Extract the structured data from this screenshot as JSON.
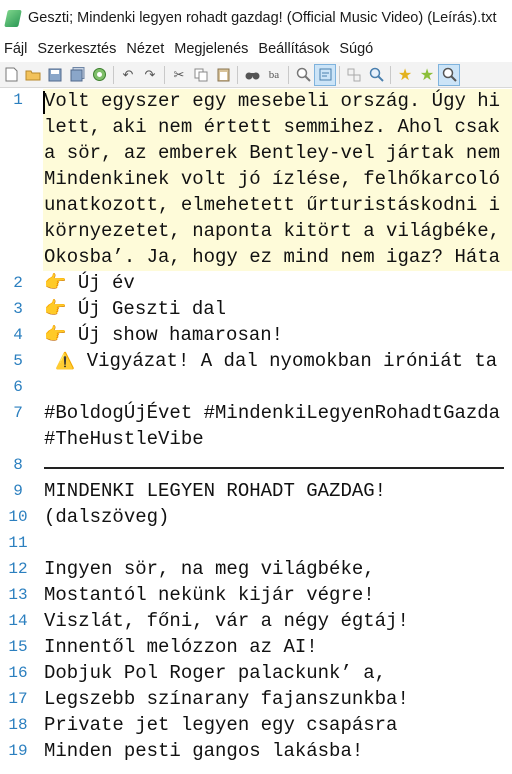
{
  "window": {
    "title": "Geszti; Mindenki legyen rohadt gazdag! (Official Music Video) (Leírás).txt"
  },
  "menu": [
    "Fájl",
    "Szerkesztés",
    "Nézet",
    "Megjelenés",
    "Beállítások",
    "Súgó"
  ],
  "toolbar": {
    "icons": [
      "new-file-icon",
      "open-folder-icon",
      "save-icon",
      "save-all-icon",
      "reload-icon",
      "undo-icon",
      "redo-icon",
      "cut-icon",
      "copy-icon",
      "paste-icon",
      "find-icon",
      "replace-icon",
      "zoom-icon",
      "word-wrap-icon",
      "select-icon",
      "zoom-in-icon",
      "bookmark-star-icon",
      "bookmark-add-icon",
      "zoom-tool-icon"
    ]
  },
  "editor": {
    "line_numbers": [
      "1",
      "2",
      "3",
      "4",
      "5",
      "6",
      "7",
      "8",
      "9",
      "10",
      "11",
      "12",
      "13",
      "14",
      "15",
      "16",
      "17",
      "18",
      "19"
    ],
    "lines": [
      "Volt egyszer egy mesebeli ország. Úgy hi",
      "lett, aki nem értett semmihez. Ahol csak",
      "a sör, az emberek Bentley-vel jártak nem",
      "Mindenkinek volt jó ízlése, felhőkarcoló",
      "unatkozott, elmehetett űrturistáskodni i",
      "környezetet, naponta kitört a világbéke,",
      "Okosba’. Ja, hogy ez mind nem igaz? Háta",
      " Új év",
      " Új Geszti dal",
      " Új show hamarosan!",
      " Vigyázat! A dal nyomokban iróniát ta",
      "",
      "#BoldogÚjÉvet #MindenkiLegyenRohadtGazda",
      "#TheHustleVibe",
      "",
      "MINDENKI LEGYEN ROHADT GAZDAG!",
      "(dalszöveg)",
      "",
      "Ingyen sör, na meg világbéke,",
      "Mostantól nekünk kijár végre!",
      "Viszlát, főni, vár a négy égtáj!",
      "Innentől melózzon az AI!",
      "Dobjuk Pol Roger palackunk’ a,",
      "Legszebb színarany fajanszunkba!",
      "Private jet legyen egy csapásra",
      "Minden pesti gangos lakásba!"
    ],
    "emoji": {
      "pointing": "👉",
      "warning": "⚠️"
    }
  }
}
